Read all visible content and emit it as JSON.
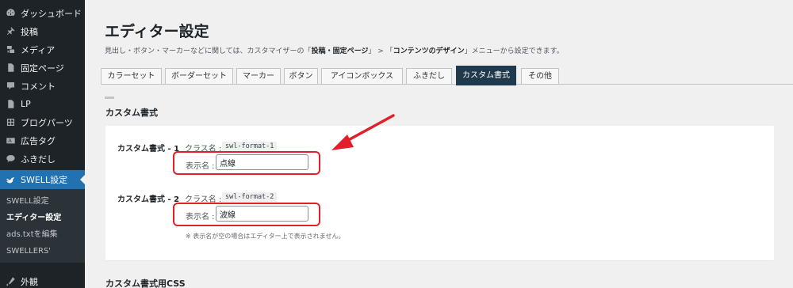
{
  "sidebar": {
    "items": [
      {
        "icon": "dashboard-icon",
        "label": "ダッシュボード"
      },
      {
        "icon": "pin-icon",
        "label": "投稿"
      },
      {
        "icon": "media-icon",
        "label": "メディア"
      },
      {
        "icon": "page-icon",
        "label": "固定ページ"
      },
      {
        "icon": "comment-icon",
        "label": "コメント"
      },
      {
        "icon": "page-icon",
        "label": "LP"
      },
      {
        "icon": "blog-parts-icon",
        "label": "ブログパーツ"
      },
      {
        "icon": "ad-tag-icon",
        "label": "広告タグ"
      },
      {
        "icon": "speech-bubble-icon",
        "label": "ふきだし"
      }
    ],
    "active_item": {
      "icon": "swell-bird-icon",
      "label": "SWELL設定"
    },
    "submenu": [
      "SWELL設定",
      "エディター設定",
      "ads.txtを編集",
      "SWELLERS'"
    ],
    "current_submenu": "エディター設定",
    "after_item": {
      "icon": "appearance-icon",
      "label": "外観"
    }
  },
  "header": {
    "title": "エディター設定",
    "desc_prefix": "見出し・ボタン・マーカーなどに関しては、カスタマイザーの「",
    "desc_bold1": "投稿・固定ページ",
    "desc_mid": "」 > 「",
    "desc_bold2": "コンテンツのデザイン",
    "desc_suffix": "」メニューから設定できます。"
  },
  "tabs": [
    {
      "label": "カラーセット",
      "active": false
    },
    {
      "label": "ボーダーセット",
      "active": false
    },
    {
      "label": "マーカー",
      "active": false
    },
    {
      "label": "ボタン",
      "active": false
    },
    {
      "label": "アイコンボックス",
      "active": false
    },
    {
      "label": "ふきだし",
      "active": false
    },
    {
      "label": "カスタム書式",
      "active": true
    },
    {
      "label": "その他",
      "active": false
    }
  ],
  "section": {
    "title": "カスタム書式",
    "formats": [
      {
        "label": "カスタム書式 - 1",
        "class_label": "クラス名 :",
        "class_name": "swl-format-1",
        "display_label": "表示名 :",
        "display_value": "点線"
      },
      {
        "label": "カスタム書式 - 2",
        "class_label": "クラス名 :",
        "class_name": "swl-format-2",
        "display_label": "表示名 :",
        "display_value": "波線"
      }
    ],
    "note": "※ 表示名が空の場合はエディター上で表示されません。"
  },
  "section2": {
    "title": "カスタム書式用CSS"
  },
  "colors": {
    "sidebar_bg": "#1d2327",
    "active_blue": "#2271b1",
    "active_tab": "#1e3a4c",
    "highlight_red": "#e0202a"
  }
}
